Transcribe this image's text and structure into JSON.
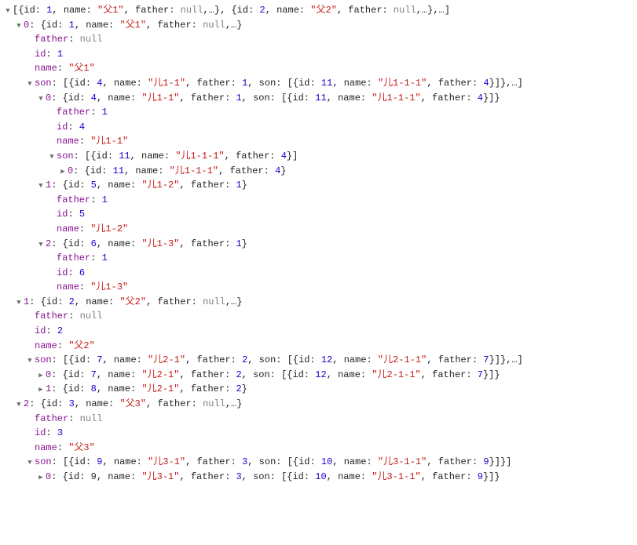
{
  "lines": [
    {
      "indent": 0,
      "arrow": "down",
      "segments": [
        {
          "t": "punct",
          "v": "[{"
        },
        {
          "t": "plain",
          "v": "id: "
        },
        {
          "t": "num",
          "v": "1"
        },
        {
          "t": "plain",
          "v": ", name: "
        },
        {
          "t": "str",
          "v": "\"父1\""
        },
        {
          "t": "plain",
          "v": ", father: "
        },
        {
          "t": "null",
          "v": "null"
        },
        {
          "t": "plain",
          "v": ",…}, {id: "
        },
        {
          "t": "num",
          "v": "2"
        },
        {
          "t": "plain",
          "v": ", name: "
        },
        {
          "t": "str",
          "v": "\"父2\""
        },
        {
          "t": "plain",
          "v": ", father: "
        },
        {
          "t": "null",
          "v": "null"
        },
        {
          "t": "plain",
          "v": ",…},…]"
        }
      ]
    },
    {
      "indent": 1,
      "arrow": "down",
      "segments": [
        {
          "t": "key",
          "v": "0"
        },
        {
          "t": "punct",
          "v": ": "
        },
        {
          "t": "plain",
          "v": "{id: "
        },
        {
          "t": "num",
          "v": "1"
        },
        {
          "t": "plain",
          "v": ", name: "
        },
        {
          "t": "str",
          "v": "\"父1\""
        },
        {
          "t": "plain",
          "v": ", father: "
        },
        {
          "t": "null",
          "v": "null"
        },
        {
          "t": "plain",
          "v": ",…}"
        }
      ]
    },
    {
      "indent": 2,
      "arrow": "none",
      "segments": [
        {
          "t": "key",
          "v": "father"
        },
        {
          "t": "punct",
          "v": ": "
        },
        {
          "t": "null",
          "v": "null"
        }
      ]
    },
    {
      "indent": 2,
      "arrow": "none",
      "segments": [
        {
          "t": "key",
          "v": "id"
        },
        {
          "t": "punct",
          "v": ": "
        },
        {
          "t": "num",
          "v": "1"
        }
      ]
    },
    {
      "indent": 2,
      "arrow": "none",
      "segments": [
        {
          "t": "key",
          "v": "name"
        },
        {
          "t": "punct",
          "v": ": "
        },
        {
          "t": "str",
          "v": "\"父1\""
        }
      ]
    },
    {
      "indent": 2,
      "arrow": "down",
      "segments": [
        {
          "t": "key",
          "v": "son"
        },
        {
          "t": "punct",
          "v": ": "
        },
        {
          "t": "plain",
          "v": "[{id: "
        },
        {
          "t": "num",
          "v": "4"
        },
        {
          "t": "plain",
          "v": ", name: "
        },
        {
          "t": "str",
          "v": "\"儿1-1\""
        },
        {
          "t": "plain",
          "v": ", father: "
        },
        {
          "t": "num",
          "v": "1"
        },
        {
          "t": "plain",
          "v": ", son: [{id: "
        },
        {
          "t": "num",
          "v": "11"
        },
        {
          "t": "plain",
          "v": ", name: "
        },
        {
          "t": "str",
          "v": "\"儿1-1-1\""
        },
        {
          "t": "plain",
          "v": ", father: "
        },
        {
          "t": "num",
          "v": "4"
        },
        {
          "t": "plain",
          "v": "}]},…]"
        }
      ]
    },
    {
      "indent": 3,
      "arrow": "down",
      "segments": [
        {
          "t": "key",
          "v": "0"
        },
        {
          "t": "punct",
          "v": ": "
        },
        {
          "t": "plain",
          "v": "{id: "
        },
        {
          "t": "num",
          "v": "4"
        },
        {
          "t": "plain",
          "v": ", name: "
        },
        {
          "t": "str",
          "v": "\"儿1-1\""
        },
        {
          "t": "plain",
          "v": ", father: "
        },
        {
          "t": "num",
          "v": "1"
        },
        {
          "t": "plain",
          "v": ", son: [{id: "
        },
        {
          "t": "num",
          "v": "11"
        },
        {
          "t": "plain",
          "v": ", name: "
        },
        {
          "t": "str",
          "v": "\"儿1-1-1\""
        },
        {
          "t": "plain",
          "v": ", father: "
        },
        {
          "t": "num",
          "v": "4"
        },
        {
          "t": "plain",
          "v": "}]}"
        }
      ]
    },
    {
      "indent": 4,
      "arrow": "none",
      "segments": [
        {
          "t": "key",
          "v": "father"
        },
        {
          "t": "punct",
          "v": ": "
        },
        {
          "t": "num",
          "v": "1"
        }
      ]
    },
    {
      "indent": 4,
      "arrow": "none",
      "segments": [
        {
          "t": "key",
          "v": "id"
        },
        {
          "t": "punct",
          "v": ": "
        },
        {
          "t": "num",
          "v": "4"
        }
      ]
    },
    {
      "indent": 4,
      "arrow": "none",
      "segments": [
        {
          "t": "key",
          "v": "name"
        },
        {
          "t": "punct",
          "v": ": "
        },
        {
          "t": "str",
          "v": "\"儿1-1\""
        }
      ]
    },
    {
      "indent": 4,
      "arrow": "down",
      "segments": [
        {
          "t": "key",
          "v": "son"
        },
        {
          "t": "punct",
          "v": ": "
        },
        {
          "t": "plain",
          "v": "[{id: "
        },
        {
          "t": "num",
          "v": "11"
        },
        {
          "t": "plain",
          "v": ", name: "
        },
        {
          "t": "str",
          "v": "\"儿1-1-1\""
        },
        {
          "t": "plain",
          "v": ", father: "
        },
        {
          "t": "num",
          "v": "4"
        },
        {
          "t": "plain",
          "v": "}]"
        }
      ]
    },
    {
      "indent": 5,
      "arrow": "right",
      "segments": [
        {
          "t": "key",
          "v": "0"
        },
        {
          "t": "punct",
          "v": ": "
        },
        {
          "t": "plain",
          "v": "{id: "
        },
        {
          "t": "num",
          "v": "11"
        },
        {
          "t": "plain",
          "v": ", name: "
        },
        {
          "t": "str",
          "v": "\"儿1-1-1\""
        },
        {
          "t": "plain",
          "v": ", father: "
        },
        {
          "t": "num",
          "v": "4"
        },
        {
          "t": "plain",
          "v": "}"
        }
      ]
    },
    {
      "indent": 3,
      "arrow": "down",
      "segments": [
        {
          "t": "key",
          "v": "1"
        },
        {
          "t": "punct",
          "v": ": "
        },
        {
          "t": "plain",
          "v": "{id: "
        },
        {
          "t": "num",
          "v": "5"
        },
        {
          "t": "plain",
          "v": ", name: "
        },
        {
          "t": "str",
          "v": "\"儿1-2\""
        },
        {
          "t": "plain",
          "v": ", father: "
        },
        {
          "t": "num",
          "v": "1"
        },
        {
          "t": "plain",
          "v": "}"
        }
      ]
    },
    {
      "indent": 4,
      "arrow": "none",
      "segments": [
        {
          "t": "key",
          "v": "father"
        },
        {
          "t": "punct",
          "v": ": "
        },
        {
          "t": "num",
          "v": "1"
        }
      ]
    },
    {
      "indent": 4,
      "arrow": "none",
      "segments": [
        {
          "t": "key",
          "v": "id"
        },
        {
          "t": "punct",
          "v": ": "
        },
        {
          "t": "num",
          "v": "5"
        }
      ]
    },
    {
      "indent": 4,
      "arrow": "none",
      "segments": [
        {
          "t": "key",
          "v": "name"
        },
        {
          "t": "punct",
          "v": ": "
        },
        {
          "t": "str",
          "v": "\"儿1-2\""
        }
      ]
    },
    {
      "indent": 3,
      "arrow": "down",
      "segments": [
        {
          "t": "key",
          "v": "2"
        },
        {
          "t": "punct",
          "v": ": "
        },
        {
          "t": "plain",
          "v": "{id: "
        },
        {
          "t": "num",
          "v": "6"
        },
        {
          "t": "plain",
          "v": ", name: "
        },
        {
          "t": "str",
          "v": "\"儿1-3\""
        },
        {
          "t": "plain",
          "v": ", father: "
        },
        {
          "t": "num",
          "v": "1"
        },
        {
          "t": "plain",
          "v": "}"
        }
      ]
    },
    {
      "indent": 4,
      "arrow": "none",
      "segments": [
        {
          "t": "key",
          "v": "father"
        },
        {
          "t": "punct",
          "v": ": "
        },
        {
          "t": "num",
          "v": "1"
        }
      ]
    },
    {
      "indent": 4,
      "arrow": "none",
      "segments": [
        {
          "t": "key",
          "v": "id"
        },
        {
          "t": "punct",
          "v": ": "
        },
        {
          "t": "num",
          "v": "6"
        }
      ]
    },
    {
      "indent": 4,
      "arrow": "none",
      "segments": [
        {
          "t": "key",
          "v": "name"
        },
        {
          "t": "punct",
          "v": ": "
        },
        {
          "t": "str",
          "v": "\"儿1-3\""
        }
      ]
    },
    {
      "indent": 1,
      "arrow": "down",
      "segments": [
        {
          "t": "key",
          "v": "1"
        },
        {
          "t": "punct",
          "v": ": "
        },
        {
          "t": "plain",
          "v": "{id: "
        },
        {
          "t": "num",
          "v": "2"
        },
        {
          "t": "plain",
          "v": ", name: "
        },
        {
          "t": "str",
          "v": "\"父2\""
        },
        {
          "t": "plain",
          "v": ", father: "
        },
        {
          "t": "null",
          "v": "null"
        },
        {
          "t": "plain",
          "v": ",…}"
        }
      ]
    },
    {
      "indent": 2,
      "arrow": "none",
      "segments": [
        {
          "t": "key",
          "v": "father"
        },
        {
          "t": "punct",
          "v": ": "
        },
        {
          "t": "null",
          "v": "null"
        }
      ]
    },
    {
      "indent": 2,
      "arrow": "none",
      "segments": [
        {
          "t": "key",
          "v": "id"
        },
        {
          "t": "punct",
          "v": ": "
        },
        {
          "t": "num",
          "v": "2"
        }
      ]
    },
    {
      "indent": 2,
      "arrow": "none",
      "segments": [
        {
          "t": "key",
          "v": "name"
        },
        {
          "t": "punct",
          "v": ": "
        },
        {
          "t": "str",
          "v": "\"父2\""
        }
      ]
    },
    {
      "indent": 2,
      "arrow": "down",
      "segments": [
        {
          "t": "key",
          "v": "son"
        },
        {
          "t": "punct",
          "v": ": "
        },
        {
          "t": "plain",
          "v": "[{id: "
        },
        {
          "t": "num",
          "v": "7"
        },
        {
          "t": "plain",
          "v": ", name: "
        },
        {
          "t": "str",
          "v": "\"儿2-1\""
        },
        {
          "t": "plain",
          "v": ", father: "
        },
        {
          "t": "num",
          "v": "2"
        },
        {
          "t": "plain",
          "v": ", son: [{id: "
        },
        {
          "t": "num",
          "v": "12"
        },
        {
          "t": "plain",
          "v": ", name: "
        },
        {
          "t": "str",
          "v": "\"儿2-1-1\""
        },
        {
          "t": "plain",
          "v": ", father: "
        },
        {
          "t": "num",
          "v": "7"
        },
        {
          "t": "plain",
          "v": "}]},…]"
        }
      ]
    },
    {
      "indent": 3,
      "arrow": "right",
      "segments": [
        {
          "t": "key",
          "v": "0"
        },
        {
          "t": "punct",
          "v": ": "
        },
        {
          "t": "plain",
          "v": "{id: "
        },
        {
          "t": "num",
          "v": "7"
        },
        {
          "t": "plain",
          "v": ", name: "
        },
        {
          "t": "str",
          "v": "\"儿2-1\""
        },
        {
          "t": "plain",
          "v": ", father: "
        },
        {
          "t": "num",
          "v": "2"
        },
        {
          "t": "plain",
          "v": ", son: [{id: "
        },
        {
          "t": "num",
          "v": "12"
        },
        {
          "t": "plain",
          "v": ", name: "
        },
        {
          "t": "str",
          "v": "\"儿2-1-1\""
        },
        {
          "t": "plain",
          "v": ", father: "
        },
        {
          "t": "num",
          "v": "7"
        },
        {
          "t": "plain",
          "v": "}]}"
        }
      ]
    },
    {
      "indent": 3,
      "arrow": "right",
      "segments": [
        {
          "t": "key",
          "v": "1"
        },
        {
          "t": "punct",
          "v": ": "
        },
        {
          "t": "plain",
          "v": "{id: "
        },
        {
          "t": "num",
          "v": "8"
        },
        {
          "t": "plain",
          "v": ", name: "
        },
        {
          "t": "str",
          "v": "\"儿2-1\""
        },
        {
          "t": "plain",
          "v": ", father: "
        },
        {
          "t": "num",
          "v": "2"
        },
        {
          "t": "plain",
          "v": "}"
        }
      ]
    },
    {
      "indent": 1,
      "arrow": "down",
      "segments": [
        {
          "t": "key",
          "v": "2"
        },
        {
          "t": "punct",
          "v": ": "
        },
        {
          "t": "plain",
          "v": "{id: "
        },
        {
          "t": "num",
          "v": "3"
        },
        {
          "t": "plain",
          "v": ", name: "
        },
        {
          "t": "str",
          "v": "\"父3\""
        },
        {
          "t": "plain",
          "v": ", father: "
        },
        {
          "t": "null",
          "v": "null"
        },
        {
          "t": "plain",
          "v": ",…}"
        }
      ]
    },
    {
      "indent": 2,
      "arrow": "none",
      "segments": [
        {
          "t": "key",
          "v": "father"
        },
        {
          "t": "punct",
          "v": ": "
        },
        {
          "t": "null",
          "v": "null"
        }
      ]
    },
    {
      "indent": 2,
      "arrow": "none",
      "segments": [
        {
          "t": "key",
          "v": "id"
        },
        {
          "t": "punct",
          "v": ": "
        },
        {
          "t": "num",
          "v": "3"
        }
      ]
    },
    {
      "indent": 2,
      "arrow": "none",
      "segments": [
        {
          "t": "key",
          "v": "name"
        },
        {
          "t": "punct",
          "v": ": "
        },
        {
          "t": "str",
          "v": "\"父3\""
        }
      ]
    },
    {
      "indent": 2,
      "arrow": "down",
      "segments": [
        {
          "t": "key",
          "v": "son"
        },
        {
          "t": "punct",
          "v": ": "
        },
        {
          "t": "plain",
          "v": "[{id: "
        },
        {
          "t": "num",
          "v": "9"
        },
        {
          "t": "plain",
          "v": ", name: "
        },
        {
          "t": "str",
          "v": "\"儿3-1\""
        },
        {
          "t": "plain",
          "v": ", father: "
        },
        {
          "t": "num",
          "v": "3"
        },
        {
          "t": "plain",
          "v": ", son: [{id: "
        },
        {
          "t": "num",
          "v": "10"
        },
        {
          "t": "plain",
          "v": ", name: "
        },
        {
          "t": "str",
          "v": "\"儿3-1-1\""
        },
        {
          "t": "plain",
          "v": ", father: "
        },
        {
          "t": "num",
          "v": "9"
        },
        {
          "t": "plain",
          "v": "}]}]"
        }
      ]
    },
    {
      "indent": 3,
      "arrow": "right",
      "segments": [
        {
          "t": "key",
          "v": "0"
        },
        {
          "t": "punct",
          "v": ": "
        },
        {
          "t": "plain",
          "v": "{id: "
        },
        {
          "t": "numardi",
          "v": "9"
        },
        {
          "t": "plain",
          "v": ", name: "
        },
        {
          "t": "str",
          "v": "\"儿3-1\""
        },
        {
          "t": "plain",
          "v": ", father: "
        },
        {
          "t": "num",
          "v": "3"
        },
        {
          "t": "plain",
          "v": ", son: [{id: "
        },
        {
          "t": "num",
          "v": "10"
        },
        {
          "t": "plain",
          "v": ", name: "
        },
        {
          "t": "str",
          "v": "\"儿3-1-1\""
        },
        {
          "t": "plain",
          "v": ", father: "
        },
        {
          "t": "num",
          "v": "9"
        },
        {
          "t": "plain",
          "v": "}]}"
        }
      ]
    }
  ]
}
